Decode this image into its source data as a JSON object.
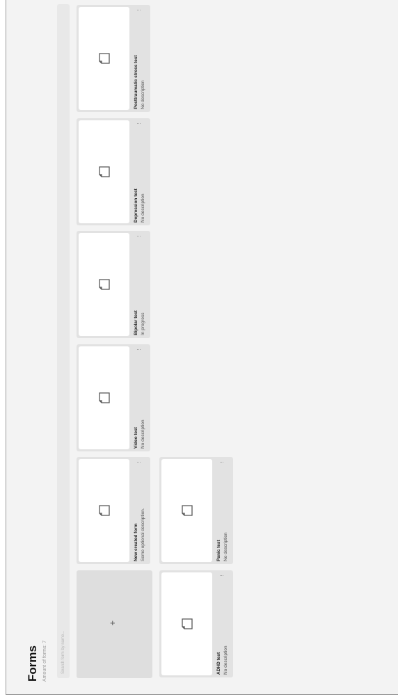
{
  "header": {
    "title": "Forms",
    "amount": "Amount of forms: 7"
  },
  "search": {
    "placeholder": "Search form by name..."
  },
  "add_card": {
    "icon": "plus-icon",
    "label": "+"
  },
  "forms": [
    {
      "title": "New created form",
      "description": "Some optional description.",
      "more": "···"
    },
    {
      "title": "Video test",
      "description": "No description",
      "more": "···"
    },
    {
      "title": "Bipolar test",
      "description": "In progress",
      "more": "···"
    },
    {
      "title": "Depression test",
      "description": "No description",
      "more": "···"
    },
    {
      "title": "Posttraumatic stress test",
      "description": "No description",
      "more": "···"
    },
    {
      "title": "ADHD test",
      "description": "No description",
      "more": "···"
    },
    {
      "title": "Panic test",
      "description": "No description",
      "more": "···"
    }
  ]
}
